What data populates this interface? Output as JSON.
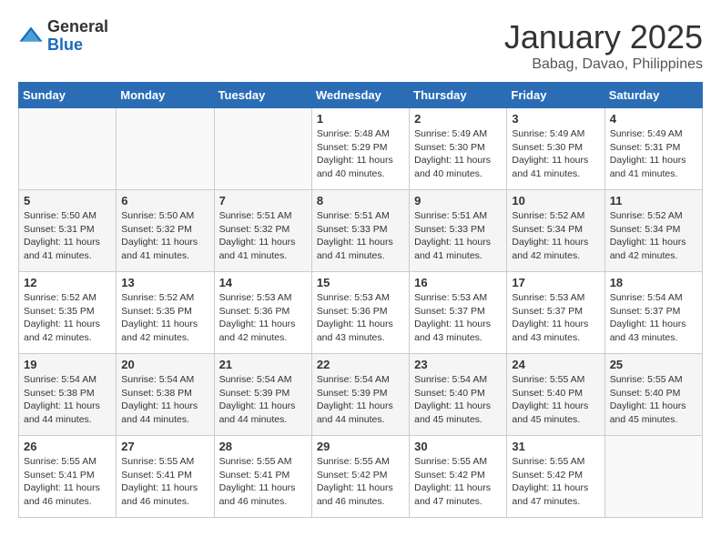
{
  "header": {
    "logo_general": "General",
    "logo_blue": "Blue",
    "month_title": "January 2025",
    "location": "Babag, Davao, Philippines"
  },
  "days_of_week": [
    "Sunday",
    "Monday",
    "Tuesday",
    "Wednesday",
    "Thursday",
    "Friday",
    "Saturday"
  ],
  "weeks": [
    [
      {
        "day": "",
        "info": ""
      },
      {
        "day": "",
        "info": ""
      },
      {
        "day": "",
        "info": ""
      },
      {
        "day": "1",
        "info": "Sunrise: 5:48 AM\nSunset: 5:29 PM\nDaylight: 11 hours\nand 40 minutes."
      },
      {
        "day": "2",
        "info": "Sunrise: 5:49 AM\nSunset: 5:30 PM\nDaylight: 11 hours\nand 40 minutes."
      },
      {
        "day": "3",
        "info": "Sunrise: 5:49 AM\nSunset: 5:30 PM\nDaylight: 11 hours\nand 41 minutes."
      },
      {
        "day": "4",
        "info": "Sunrise: 5:49 AM\nSunset: 5:31 PM\nDaylight: 11 hours\nand 41 minutes."
      }
    ],
    [
      {
        "day": "5",
        "info": "Sunrise: 5:50 AM\nSunset: 5:31 PM\nDaylight: 11 hours\nand 41 minutes."
      },
      {
        "day": "6",
        "info": "Sunrise: 5:50 AM\nSunset: 5:32 PM\nDaylight: 11 hours\nand 41 minutes."
      },
      {
        "day": "7",
        "info": "Sunrise: 5:51 AM\nSunset: 5:32 PM\nDaylight: 11 hours\nand 41 minutes."
      },
      {
        "day": "8",
        "info": "Sunrise: 5:51 AM\nSunset: 5:33 PM\nDaylight: 11 hours\nand 41 minutes."
      },
      {
        "day": "9",
        "info": "Sunrise: 5:51 AM\nSunset: 5:33 PM\nDaylight: 11 hours\nand 41 minutes."
      },
      {
        "day": "10",
        "info": "Sunrise: 5:52 AM\nSunset: 5:34 PM\nDaylight: 11 hours\nand 42 minutes."
      },
      {
        "day": "11",
        "info": "Sunrise: 5:52 AM\nSunset: 5:34 PM\nDaylight: 11 hours\nand 42 minutes."
      }
    ],
    [
      {
        "day": "12",
        "info": "Sunrise: 5:52 AM\nSunset: 5:35 PM\nDaylight: 11 hours\nand 42 minutes."
      },
      {
        "day": "13",
        "info": "Sunrise: 5:52 AM\nSunset: 5:35 PM\nDaylight: 11 hours\nand 42 minutes."
      },
      {
        "day": "14",
        "info": "Sunrise: 5:53 AM\nSunset: 5:36 PM\nDaylight: 11 hours\nand 42 minutes."
      },
      {
        "day": "15",
        "info": "Sunrise: 5:53 AM\nSunset: 5:36 PM\nDaylight: 11 hours\nand 43 minutes."
      },
      {
        "day": "16",
        "info": "Sunrise: 5:53 AM\nSunset: 5:37 PM\nDaylight: 11 hours\nand 43 minutes."
      },
      {
        "day": "17",
        "info": "Sunrise: 5:53 AM\nSunset: 5:37 PM\nDaylight: 11 hours\nand 43 minutes."
      },
      {
        "day": "18",
        "info": "Sunrise: 5:54 AM\nSunset: 5:37 PM\nDaylight: 11 hours\nand 43 minutes."
      }
    ],
    [
      {
        "day": "19",
        "info": "Sunrise: 5:54 AM\nSunset: 5:38 PM\nDaylight: 11 hours\nand 44 minutes."
      },
      {
        "day": "20",
        "info": "Sunrise: 5:54 AM\nSunset: 5:38 PM\nDaylight: 11 hours\nand 44 minutes."
      },
      {
        "day": "21",
        "info": "Sunrise: 5:54 AM\nSunset: 5:39 PM\nDaylight: 11 hours\nand 44 minutes."
      },
      {
        "day": "22",
        "info": "Sunrise: 5:54 AM\nSunset: 5:39 PM\nDaylight: 11 hours\nand 44 minutes."
      },
      {
        "day": "23",
        "info": "Sunrise: 5:54 AM\nSunset: 5:40 PM\nDaylight: 11 hours\nand 45 minutes."
      },
      {
        "day": "24",
        "info": "Sunrise: 5:55 AM\nSunset: 5:40 PM\nDaylight: 11 hours\nand 45 minutes."
      },
      {
        "day": "25",
        "info": "Sunrise: 5:55 AM\nSunset: 5:40 PM\nDaylight: 11 hours\nand 45 minutes."
      }
    ],
    [
      {
        "day": "26",
        "info": "Sunrise: 5:55 AM\nSunset: 5:41 PM\nDaylight: 11 hours\nand 46 minutes."
      },
      {
        "day": "27",
        "info": "Sunrise: 5:55 AM\nSunset: 5:41 PM\nDaylight: 11 hours\nand 46 minutes."
      },
      {
        "day": "28",
        "info": "Sunrise: 5:55 AM\nSunset: 5:41 PM\nDaylight: 11 hours\nand 46 minutes."
      },
      {
        "day": "29",
        "info": "Sunrise: 5:55 AM\nSunset: 5:42 PM\nDaylight: 11 hours\nand 46 minutes."
      },
      {
        "day": "30",
        "info": "Sunrise: 5:55 AM\nSunset: 5:42 PM\nDaylight: 11 hours\nand 47 minutes."
      },
      {
        "day": "31",
        "info": "Sunrise: 5:55 AM\nSunset: 5:42 PM\nDaylight: 11 hours\nand 47 minutes."
      },
      {
        "day": "",
        "info": ""
      }
    ]
  ]
}
